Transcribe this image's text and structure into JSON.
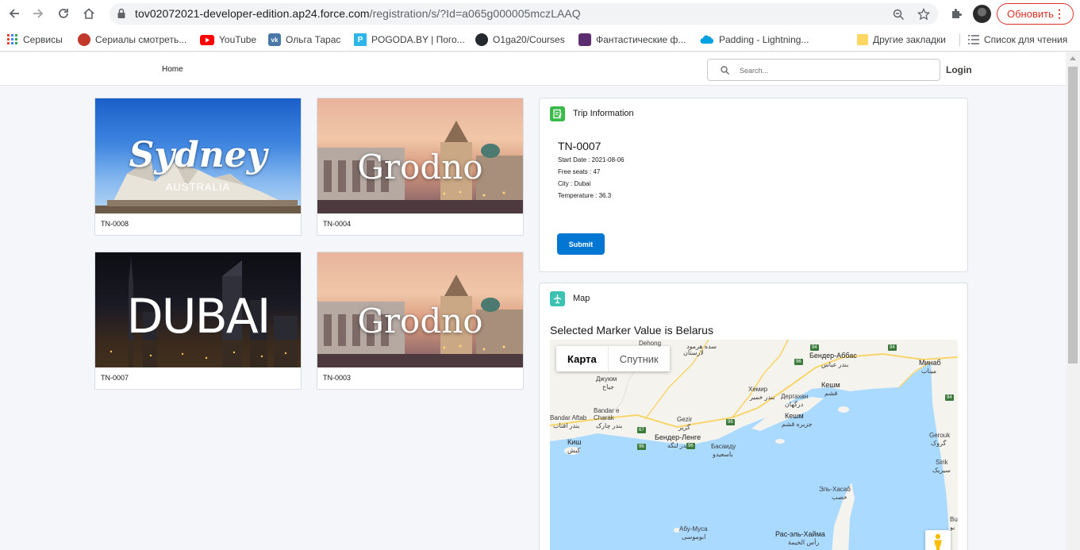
{
  "browser": {
    "url_host": "tov02072021-developer-edition.ap24.force.com",
    "url_path": "/registration/s/?Id=a065g000005mczLAAQ",
    "update_button": "Обновить",
    "bookmarks": [
      {
        "label": "Сервисы",
        "icon": "apps-grid-icon"
      },
      {
        "label": "Сериалы смотреть...",
        "icon": "site-favicon"
      },
      {
        "label": "YouTube",
        "icon": "youtube-icon"
      },
      {
        "label": "Ольга Тарас",
        "icon": "vk-icon"
      },
      {
        "label": "POGODA.BY | Пого...",
        "icon": "pogoda-icon"
      },
      {
        "label": "O1ga20/Courses",
        "icon": "github-icon"
      },
      {
        "label": "Фантастические ф...",
        "icon": "site-favicon"
      },
      {
        "label": "Padding - Lightning...",
        "icon": "salesforce-cloud-icon"
      }
    ],
    "other_bookmarks": "Другие закладки",
    "reading_list": "Список для чтения"
  },
  "header": {
    "home": "Home",
    "search_placeholder": "Search...",
    "login": "Login"
  },
  "trips": [
    {
      "id": "TN-0008",
      "city_art": "Sydney",
      "city_sub": "AUSTRALIA"
    },
    {
      "id": "TN-0004",
      "city_art": "Grodno"
    },
    {
      "id": "TN-0007",
      "city_art": "DUBAI"
    },
    {
      "id": "TN-0003",
      "city_art": "Grodno"
    }
  ],
  "trip_info": {
    "title": "Trip Information",
    "trip_number": "TN-0007",
    "start_date": "Start Date : 2021-08-06",
    "free_seats": "Free seats : 47",
    "city": "City : Dubai",
    "temperature": "Temperature : 36.3",
    "submit": "Submit"
  },
  "map_panel": {
    "title": "Map",
    "marker_text": "Selected Marker Value is Belarus",
    "tab_map": "Карта",
    "tab_satellite": "Спутник",
    "labels": {
      "dehong": "Dehong",
      "sedeh": "سده هرمود",
      "laristan": "لارستان",
      "bandar_abbas": "Бендер-Аббас",
      "bandar_abbas_fa": "بندر عباس",
      "minab": "Минаб",
      "minab_fa": "میناب",
      "jouyom": "Джуюм",
      "jouyom_fa": "جیاح",
      "khamir": "Хемир",
      "khamir_fa": "بندر خمیر",
      "dargahan": "Дергахан",
      "dargahan_fa": "درگهان",
      "qeshm": "Кешм",
      "qeshm_fa": "قشم",
      "qeshm_island": "Кешм",
      "qeshm_island_fa": "جزیره قشم",
      "bandar_charak": "Bandar e Charak",
      "bandar_charak_fa": "بندر چارک",
      "bandar_aftab": "Bandar Aftab",
      "bandar_aftab_fa": "بندر افتاب",
      "gezir": "Gezir",
      "gezir_fa": "گزیر",
      "bandar_lengeh": "Бендер-Ленге",
      "bandar_lengeh_fa": "بندر لنگه",
      "basaidu": "Басаиду",
      "basaidu_fa": "باسعیدو",
      "kish": "Киш",
      "kish_fa": "کیش",
      "gerouk": "Gerouk",
      "gerouk_fa": "گروک",
      "sirik": "Sirik",
      "sirik_fa": "سیریک",
      "khasab": "Эль-Хасаб",
      "khasab_ar": "خصب",
      "abu_musa": "Абу-Муса",
      "abu_musa_fa": "ابوموسی",
      "ras_al_khaimah": "Рас-эль-Хайма",
      "ras_al_khaimah_ar": "رأس الخيمة",
      "bu": "Bu",
      "bu2": "بو"
    },
    "road_numbers": [
      "94",
      "96",
      "94",
      "96",
      "67",
      "96",
      "96",
      "94"
    ]
  }
}
